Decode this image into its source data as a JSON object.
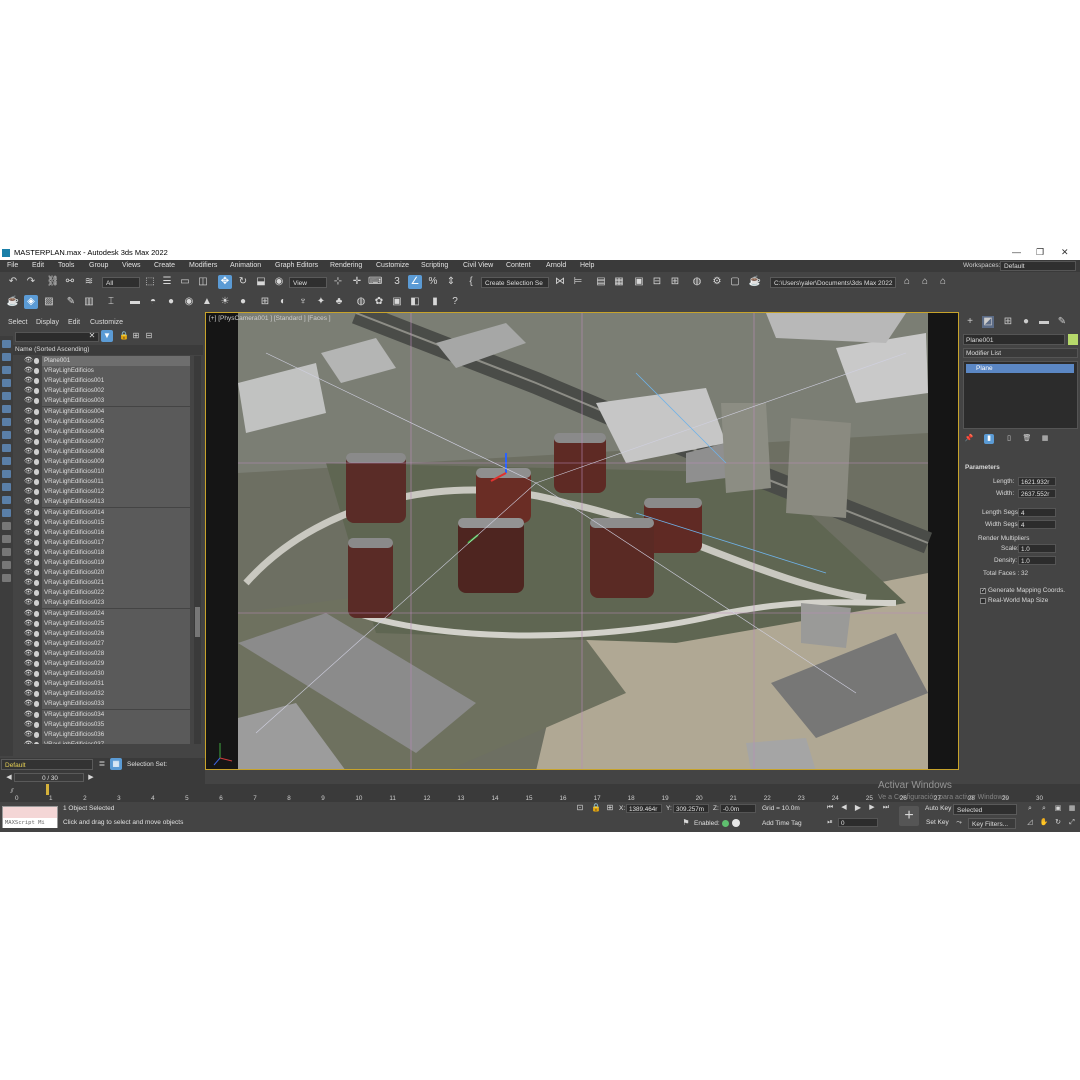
{
  "window": {
    "title": "MASTERPLAN.max - Autodesk 3ds Max 2022",
    "controls": [
      "—",
      "❐",
      "✕"
    ]
  },
  "menu": {
    "items": [
      "File",
      "Edit",
      "Tools",
      "Group",
      "Views",
      "Create",
      "Modifiers",
      "Animation",
      "Graph Editors",
      "Rendering",
      "Customize",
      "Scripting",
      "Civil View",
      "Content",
      "Arnold",
      "Help"
    ],
    "workspaces_label": "Workspaces:",
    "workspace_value": "Default"
  },
  "toolbar": {
    "selection_filter": "All",
    "reference_coord": "View",
    "named_selection": "Create Selection Se",
    "project_path": "C:\\Users\\yaler\\Documents\\3ds Max 2022"
  },
  "scene_explorer": {
    "menu": [
      "Select",
      "Display",
      "Edit",
      "Customize"
    ],
    "header": "Name (Sorted Ascending)",
    "items": [
      "Plane001",
      "VRayLighEdificios",
      "VRayLighEdificios001",
      "VRayLighEdificios002",
      "VRayLighEdificios003",
      "VRayLighEdificios004",
      "VRayLighEdificios005",
      "VRayLighEdificios006",
      "VRayLighEdificios007",
      "VRayLighEdificios008",
      "VRayLighEdificios009",
      "VRayLighEdificios010",
      "VRayLighEdificios011",
      "VRayLighEdificios012",
      "VRayLighEdificios013",
      "VRayLighEdificios014",
      "VRayLighEdificios015",
      "VRayLighEdificios016",
      "VRayLighEdificios017",
      "VRayLighEdificios018",
      "VRayLighEdificios019",
      "VRayLighEdificios020",
      "VRayLighEdificios021",
      "VRayLighEdificios022",
      "VRayLighEdificios023",
      "VRayLighEdificios024",
      "VRayLighEdificios025",
      "VRayLighEdificios026",
      "VRayLighEdificios027",
      "VRayLighEdificios028",
      "VRayLighEdificios029",
      "VRayLighEdificios030",
      "VRayLighEdificios031",
      "VRayLighEdificios032",
      "VRayLighEdificios033",
      "VRayLighEdificios034",
      "VRayLighEdificios035",
      "VRayLighEdificios036",
      "VRayLighEdificios037"
    ],
    "selected_item": "Plane001"
  },
  "layer": {
    "name": "Default",
    "selection_set_label": "Selection Set:"
  },
  "viewport": {
    "label": "[+] [PhysCamera001 ] [Standard ] [Faces ]"
  },
  "command_panel": {
    "object_name": "Plane001",
    "object_color": "#b6d96b",
    "modifier_list": "Modifier List",
    "stack_item": "Plane",
    "rollout_title": "Parameters",
    "length_label": "Length:",
    "length_value": "1621.932r",
    "width_label": "Width:",
    "width_value": "2637.552r",
    "length_segs_label": "Length Segs:",
    "length_segs_value": "4",
    "width_segs_label": "Width Segs:",
    "width_segs_value": "4",
    "render_multipliers_label": "Render Multipliers",
    "scale_label": "Scale:",
    "scale_value": "1.0",
    "density_label": "Density:",
    "density_value": "1.0",
    "total_faces": "Total Faces : 32",
    "gen_mapping_label": "Generate Mapping Coords.",
    "gen_mapping_checked": true,
    "real_world_label": "Real-World Map Size",
    "real_world_checked": false
  },
  "timeline": {
    "frame_display": "0 / 30",
    "ticks": [
      "0",
      "1",
      "2",
      "3",
      "4",
      "5",
      "6",
      "7",
      "8",
      "9",
      "10",
      "11",
      "12",
      "13",
      "14",
      "15",
      "16",
      "17",
      "18",
      "19",
      "20",
      "21",
      "22",
      "23",
      "24",
      "25",
      "26",
      "27",
      "28",
      "29",
      "30"
    ]
  },
  "status": {
    "maxscript_label": "MAXScript Mi",
    "selection_status": "1 Object Selected",
    "prompt": "Click and drag to select and move objects",
    "x_label": "X:",
    "x_value": "1389.464r",
    "y_label": "Y:",
    "y_value": "309.257m",
    "z_label": "Z:",
    "z_value": "-0.0m",
    "grid": "Grid = 10.0m",
    "enabled_label": "Enabled:",
    "add_time_tag": "Add Time Tag",
    "auto_key": "Auto Key",
    "set_key": "Set Key",
    "selected": "Selected",
    "key_filters": "Key Filters...",
    "current_frame": "0"
  },
  "watermark": {
    "line1": "Activar Windows",
    "line2": "Ve a Configuración para activar Windows."
  }
}
